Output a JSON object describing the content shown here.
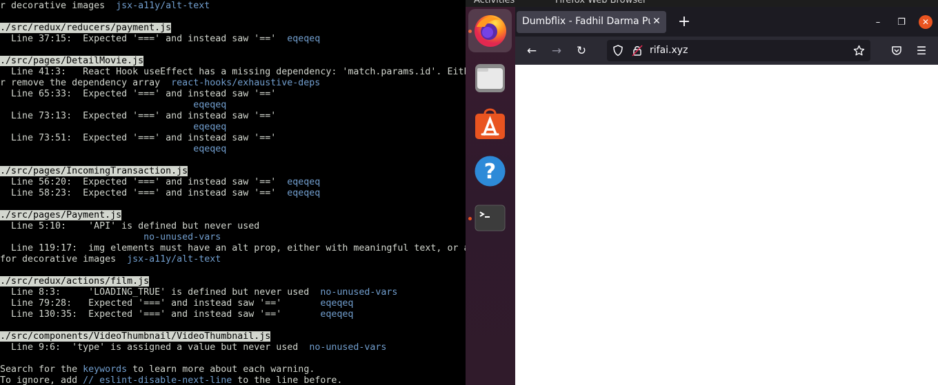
{
  "terminal": {
    "lines": [
      {
        "t": "r decorative images  ",
        "rule": "jsx-a11y/alt-text"
      },
      {
        "t": ""
      },
      {
        "file": "./src/redux/reducers/payment.js"
      },
      {
        "t": "  Line 37:15:  Expected '===' and instead saw '=='  ",
        "rule": "eqeqeq"
      },
      {
        "t": ""
      },
      {
        "file": "./src/pages/DetailMovie.js"
      },
      {
        "t": "  Line 41:3:   React Hook useEffect has a missing dependency: 'match.params.id'. Eith"
      },
      {
        "t": "r remove the dependency array  ",
        "rule": "react-hooks/exhaustive-deps"
      },
      {
        "t": "  Line 65:33:  Expected '===' and instead saw '=='"
      },
      {
        "t": "                                   ",
        "rule": "eqeqeq"
      },
      {
        "t": "  Line 73:13:  Expected '===' and instead saw '=='"
      },
      {
        "t": "                                   ",
        "rule": "eqeqeq"
      },
      {
        "t": "  Line 73:51:  Expected '===' and instead saw '=='"
      },
      {
        "t": "                                   ",
        "rule": "eqeqeq"
      },
      {
        "t": ""
      },
      {
        "file": "./src/pages/IncomingTransaction.js"
      },
      {
        "t": "  Line 56:20:  Expected '===' and instead saw '=='  ",
        "rule": "eqeqeq"
      },
      {
        "t": "  Line 58:23:  Expected '===' and instead saw '=='  ",
        "rule": "eqeqeq"
      },
      {
        "t": ""
      },
      {
        "file": "./src/pages/Payment.js"
      },
      {
        "t": "  Line 5:10:    'API' is defined but never used"
      },
      {
        "t": "                          ",
        "rule": "no-unused-vars"
      },
      {
        "t": "  Line 119:17:  img elements must have an alt prop, either with meaningful text, or a"
      },
      {
        "t": "for decorative images  ",
        "rule": "jsx-a11y/alt-text"
      },
      {
        "t": ""
      },
      {
        "file": "./src/redux/actions/film.js"
      },
      {
        "t": "  Line 8:3:     'LOADING_TRUE' is defined but never used  ",
        "rule": "no-unused-vars"
      },
      {
        "t": "  Line 79:28:   Expected '===' and instead saw '=='       ",
        "rule": "eqeqeq"
      },
      {
        "t": "  Line 130:35:  Expected '===' and instead saw '=='       ",
        "rule": "eqeqeq"
      },
      {
        "t": ""
      },
      {
        "file": "./src/components/VideoThumbnail/VideoThumbnail.js"
      },
      {
        "t": "  Line 9:6:  'type' is assigned a value but never used  ",
        "rule": "no-unused-vars"
      },
      {
        "t": ""
      },
      {
        "t": "Search for the ",
        "rule": "keywords",
        "after": " to learn more about each warning."
      },
      {
        "t": "To ignore, add ",
        "rule": "// eslint-disable-next-line",
        "after": " to the line before."
      }
    ]
  },
  "top_panel": {
    "activities_label": "Activities",
    "app_label": "Firefox Web Browser"
  },
  "dock": {
    "items": [
      {
        "name": "firefox",
        "running": true,
        "active": true
      },
      {
        "name": "files",
        "running": false,
        "active": false
      },
      {
        "name": "software",
        "running": false,
        "active": false
      },
      {
        "name": "help",
        "running": false,
        "active": false
      },
      {
        "name": "terminal",
        "running": true,
        "active": false
      }
    ]
  },
  "browser": {
    "tab_title": "Dumbflix - Fadhil Darma Putera",
    "url": "rifai.xyz"
  },
  "colors": {
    "terminal_fg": "#d3d7cf",
    "rule": "#729fcf",
    "ubuntu_orange": "#e95420",
    "ff_tabbar": "#1c1b22",
    "ff_navbar": "#2b2a33"
  }
}
